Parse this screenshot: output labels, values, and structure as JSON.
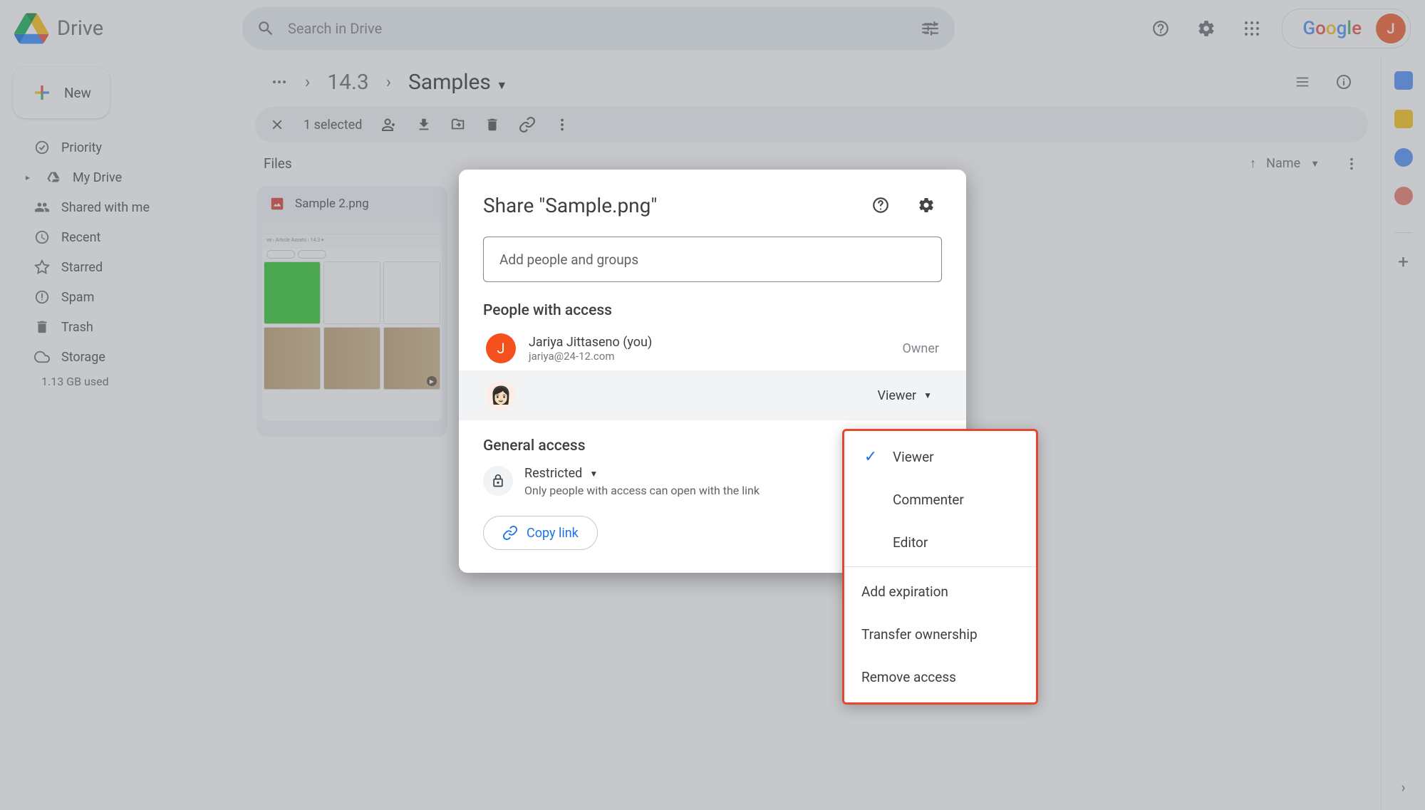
{
  "app": {
    "title": "Drive"
  },
  "search": {
    "placeholder": "Search in Drive"
  },
  "header": {
    "google": "Google",
    "avatar_letter": "J"
  },
  "new_button": {
    "label": "New"
  },
  "nav": [
    {
      "label": "Priority"
    },
    {
      "label": "My Drive"
    },
    {
      "label": "Shared with me"
    },
    {
      "label": "Recent"
    },
    {
      "label": "Starred"
    },
    {
      "label": "Spam"
    },
    {
      "label": "Trash"
    },
    {
      "label": "Storage"
    }
  ],
  "storage_used": "1.13 GB used",
  "breadcrumb": {
    "prev": "14.3",
    "current": "Samples"
  },
  "action_bar": {
    "selected": "1 selected"
  },
  "files": {
    "heading": "Files",
    "sort_label": "Name",
    "cards": [
      {
        "title": "Sample 2.png"
      }
    ]
  },
  "share": {
    "title": "Share \"Sample.png\"",
    "add_placeholder": "Add people and groups",
    "people_heading": "People with access",
    "owner": {
      "name": "Jariya Jittaseno (you)",
      "email": "jariya@24-12.com",
      "role": "Owner",
      "letter": "J"
    },
    "user2_role": "Viewer",
    "general_heading": "General access",
    "restricted_label": "Restricted",
    "restricted_sub": "Only people with access can open with the link",
    "copy_link": "Copy link"
  },
  "role_menu": {
    "viewer": "Viewer",
    "commenter": "Commenter",
    "editor": "Editor",
    "add_exp": "Add expiration",
    "transfer": "Transfer ownership",
    "remove": "Remove access"
  }
}
